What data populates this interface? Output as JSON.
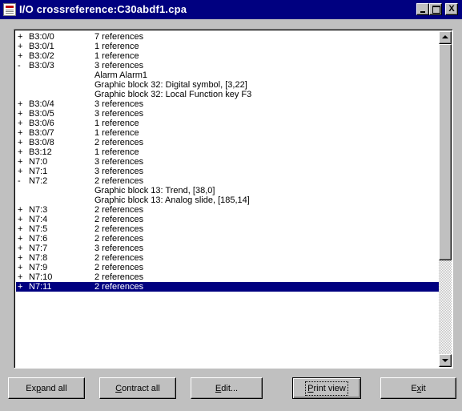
{
  "window": {
    "title": "I/O crossreference:C30abdf1.cpa",
    "icon": "document-app-icon",
    "controls": [
      "minimize",
      "maximize",
      "close"
    ],
    "close_glyph": "X"
  },
  "list": {
    "selection_color": "#000080",
    "rows": [
      {
        "exp": "+",
        "key": "B3:0/0",
        "desc": "7 references"
      },
      {
        "exp": "+",
        "key": "B3:0/1",
        "desc": "1 reference"
      },
      {
        "exp": "+",
        "key": "B3:0/2",
        "desc": "1 reference"
      },
      {
        "exp": "-",
        "key": "B3:0/3",
        "desc": "3 references"
      },
      {
        "exp": "",
        "key": "",
        "desc": "Alarm Alarm1"
      },
      {
        "exp": "",
        "key": "",
        "desc": "Graphic block 32: Digital symbol, [3,22]"
      },
      {
        "exp": "",
        "key": "",
        "desc": "Graphic block 32: Local Function key F3"
      },
      {
        "exp": "+",
        "key": "B3:0/4",
        "desc": "3 references"
      },
      {
        "exp": "+",
        "key": "B3:0/5",
        "desc": "3 references"
      },
      {
        "exp": "+",
        "key": "B3:0/6",
        "desc": "1 reference"
      },
      {
        "exp": "+",
        "key": "B3:0/7",
        "desc": "1 reference"
      },
      {
        "exp": "+",
        "key": "B3:0/8",
        "desc": "2 references"
      },
      {
        "exp": "+",
        "key": "B3:12",
        "desc": "1 reference"
      },
      {
        "exp": "+",
        "key": "N7:0",
        "desc": "3 references"
      },
      {
        "exp": "+",
        "key": "N7:1",
        "desc": "3 references"
      },
      {
        "exp": "-",
        "key": "N7:2",
        "desc": "2 references"
      },
      {
        "exp": "",
        "key": "",
        "desc": "Graphic block 13: Trend, [38,0]"
      },
      {
        "exp": "",
        "key": "",
        "desc": "Graphic block 13: Analog slide, [185,14]"
      },
      {
        "exp": "+",
        "key": "N7:3",
        "desc": "2 references"
      },
      {
        "exp": "+",
        "key": "N7:4",
        "desc": "2 references"
      },
      {
        "exp": "+",
        "key": "N7:5",
        "desc": "2 references"
      },
      {
        "exp": "+",
        "key": "N7:6",
        "desc": "2 references"
      },
      {
        "exp": "+",
        "key": "N7:7",
        "desc": "3 references"
      },
      {
        "exp": "+",
        "key": "N7:8",
        "desc": "2 references"
      },
      {
        "exp": "+",
        "key": "N7:9",
        "desc": "2 references"
      },
      {
        "exp": "+",
        "key": "N7:10",
        "desc": "2 references"
      },
      {
        "exp": "+",
        "key": "N7:11",
        "desc": "2 references",
        "selected": true
      }
    ]
  },
  "buttons": {
    "expand_all": {
      "pre": "Ex",
      "acc": "p",
      "post": "and all"
    },
    "contract_all": {
      "pre": "",
      "acc": "C",
      "post": "ontract all"
    },
    "edit": {
      "pre": "",
      "acc": "E",
      "post": "dit..."
    },
    "print_view": {
      "pre": "",
      "acc": "P",
      "post": "rint view"
    },
    "exit": {
      "pre": "E",
      "acc": "x",
      "post": "it"
    }
  }
}
